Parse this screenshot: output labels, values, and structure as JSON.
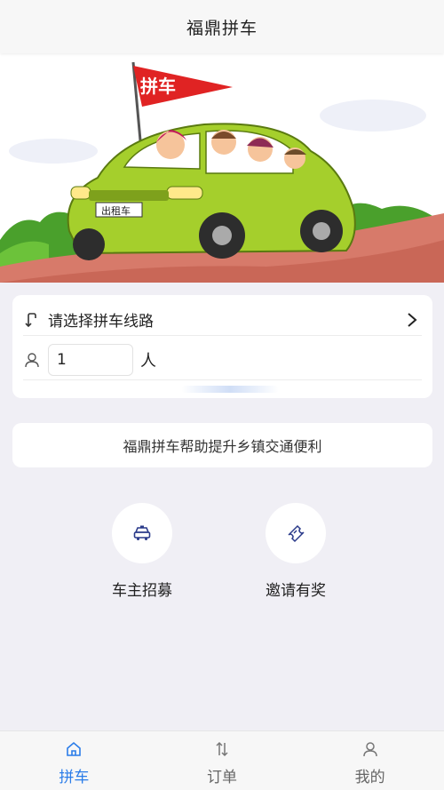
{
  "header": {
    "title": "福鼎拼车"
  },
  "banner": {
    "flag_text": "拼车",
    "plate_text": "出租车"
  },
  "route": {
    "select_label": "请选择拼车线路",
    "passenger_count": "1",
    "passenger_unit": "人"
  },
  "notice": {
    "text": "福鼎拼车帮助提升乡镇交通便利"
  },
  "actions": [
    {
      "label": "车主招募",
      "icon": "car-icon"
    },
    {
      "label": "邀请有奖",
      "icon": "ticket-icon"
    }
  ],
  "tabbar": {
    "active_color": "#2b7de9",
    "tabs": [
      {
        "label": "拼车",
        "icon": "home-icon",
        "active": true
      },
      {
        "label": "订单",
        "icon": "sort-arrows-icon",
        "active": false
      },
      {
        "label": "我的",
        "icon": "user-icon",
        "active": false
      }
    ]
  }
}
